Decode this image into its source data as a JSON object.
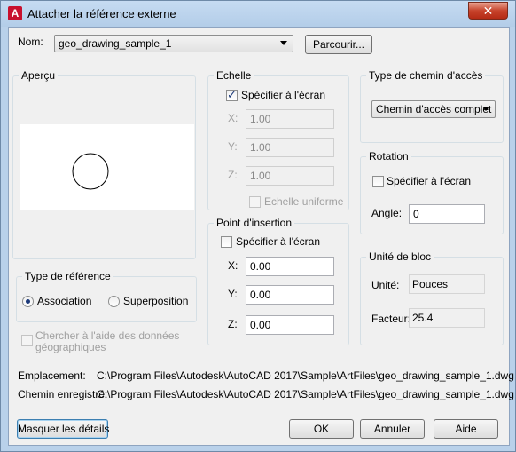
{
  "window": {
    "title": "Attacher la référence externe",
    "close_glyph": "✕",
    "app_icon_letter": "A"
  },
  "name_row": {
    "label": "Nom:",
    "value": "geo_drawing_sample_1",
    "browse_label": "Parcourir..."
  },
  "preview": {
    "title": "Aperçu"
  },
  "reference_type": {
    "title": "Type de référence",
    "attach_label": "Association",
    "overlay_label": "Superposition",
    "selected": "Association"
  },
  "geo": {
    "label_line1": "Chercher à l'aide des données",
    "label_line2": "géographiques"
  },
  "scale": {
    "title": "Echelle",
    "specify_label": "Spécifier à l'écran",
    "specify_checked": true,
    "x_label": "X:",
    "x_value": "1.00",
    "y_label": "Y:",
    "y_value": "1.00",
    "z_label": "Z:",
    "z_value": "1.00",
    "uniform_label": "Echelle uniforme"
  },
  "insertion": {
    "title": "Point d'insertion",
    "specify_label": "Spécifier à l'écran",
    "specify_checked": false,
    "x_label": "X:",
    "x_value": "0.00",
    "y_label": "Y:",
    "y_value": "0.00",
    "z_label": "Z:",
    "z_value": "0.00"
  },
  "path_type": {
    "title": "Type de chemin d'accès",
    "value": "Chemin d'accès complet"
  },
  "rotation": {
    "title": "Rotation",
    "specify_label": "Spécifier à l'écran",
    "angle_label": "Angle:",
    "angle_value": "0"
  },
  "block_unit": {
    "title": "Unité de bloc",
    "unit_label": "Unité:",
    "unit_value": "Pouces",
    "factor_label": "Facteur:",
    "factor_value": "25.4"
  },
  "location": {
    "found_label": "Emplacement:",
    "found_value": "C:\\Program Files\\Autodesk\\AutoCAD 2017\\Sample\\ArtFiles\\geo_drawing_sample_1.dwg",
    "saved_label": "Chemin enregistré:",
    "saved_value": "C:\\Program Files\\Autodesk\\AutoCAD 2017\\Sample\\ArtFiles\\geo_drawing_sample_1.dwg"
  },
  "buttons": {
    "hide_details": "Masquer les détails",
    "ok": "OK",
    "cancel": "Annuler",
    "help": "Aide"
  },
  "icons": {
    "app": "autocad-logo-icon",
    "close": "close-icon",
    "dropdown": "chevron-down-icon",
    "check": "checkmark-icon"
  }
}
